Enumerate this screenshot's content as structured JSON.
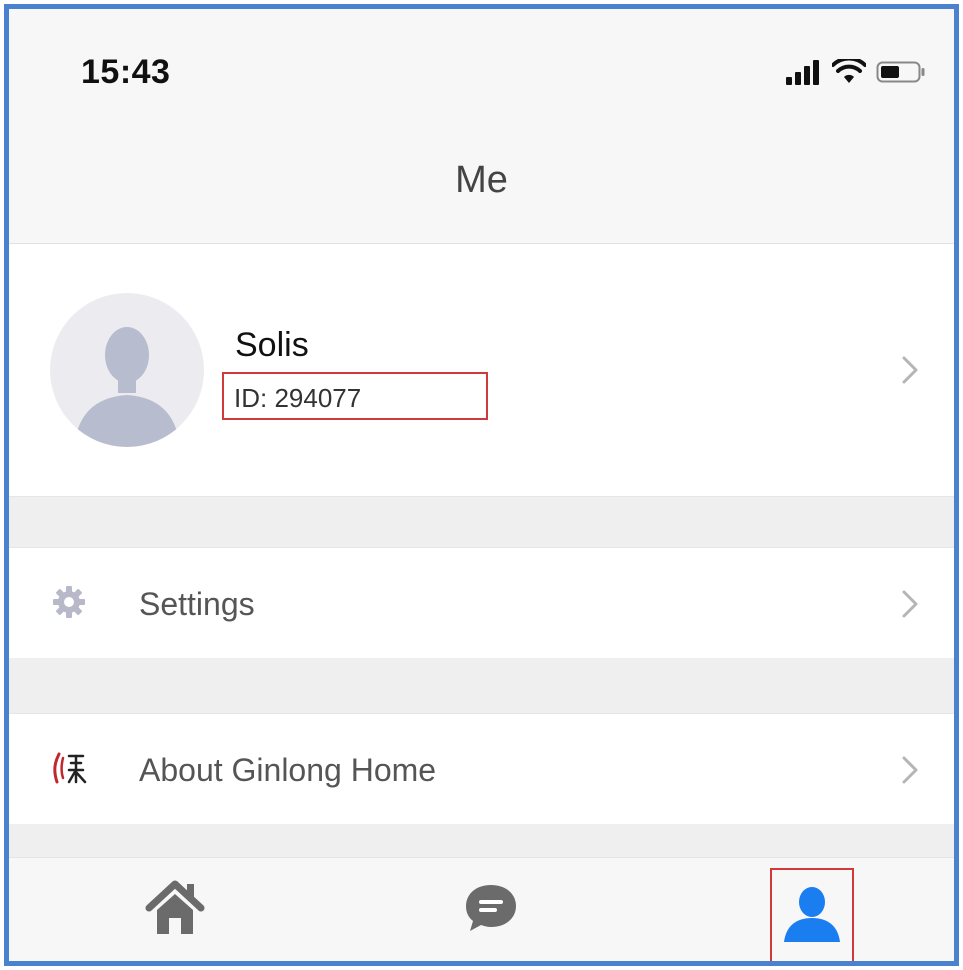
{
  "status_bar": {
    "time": "15:43",
    "icons": [
      "cellular-signal-icon",
      "wifi-icon",
      "battery-icon"
    ]
  },
  "nav": {
    "title": "Me"
  },
  "profile": {
    "name": "Solis",
    "id_text": "ID: 294077",
    "avatar_icon": "person-silhouette-icon"
  },
  "menu": {
    "items": [
      {
        "label": "Settings",
        "icon": "gear-icon"
      },
      {
        "label": "About Ginlong Home",
        "icon": "ginlong-logo-icon"
      }
    ]
  },
  "tabs": [
    {
      "icon": "home-icon",
      "active": false
    },
    {
      "icon": "message-icon",
      "active": false
    },
    {
      "icon": "user-icon",
      "active": true
    }
  ],
  "colors": {
    "accent": "#1a7df0",
    "inactive_icon": "#6b6b6b",
    "highlight_box": "#d23a3a",
    "frame_border": "#4a82cf"
  }
}
